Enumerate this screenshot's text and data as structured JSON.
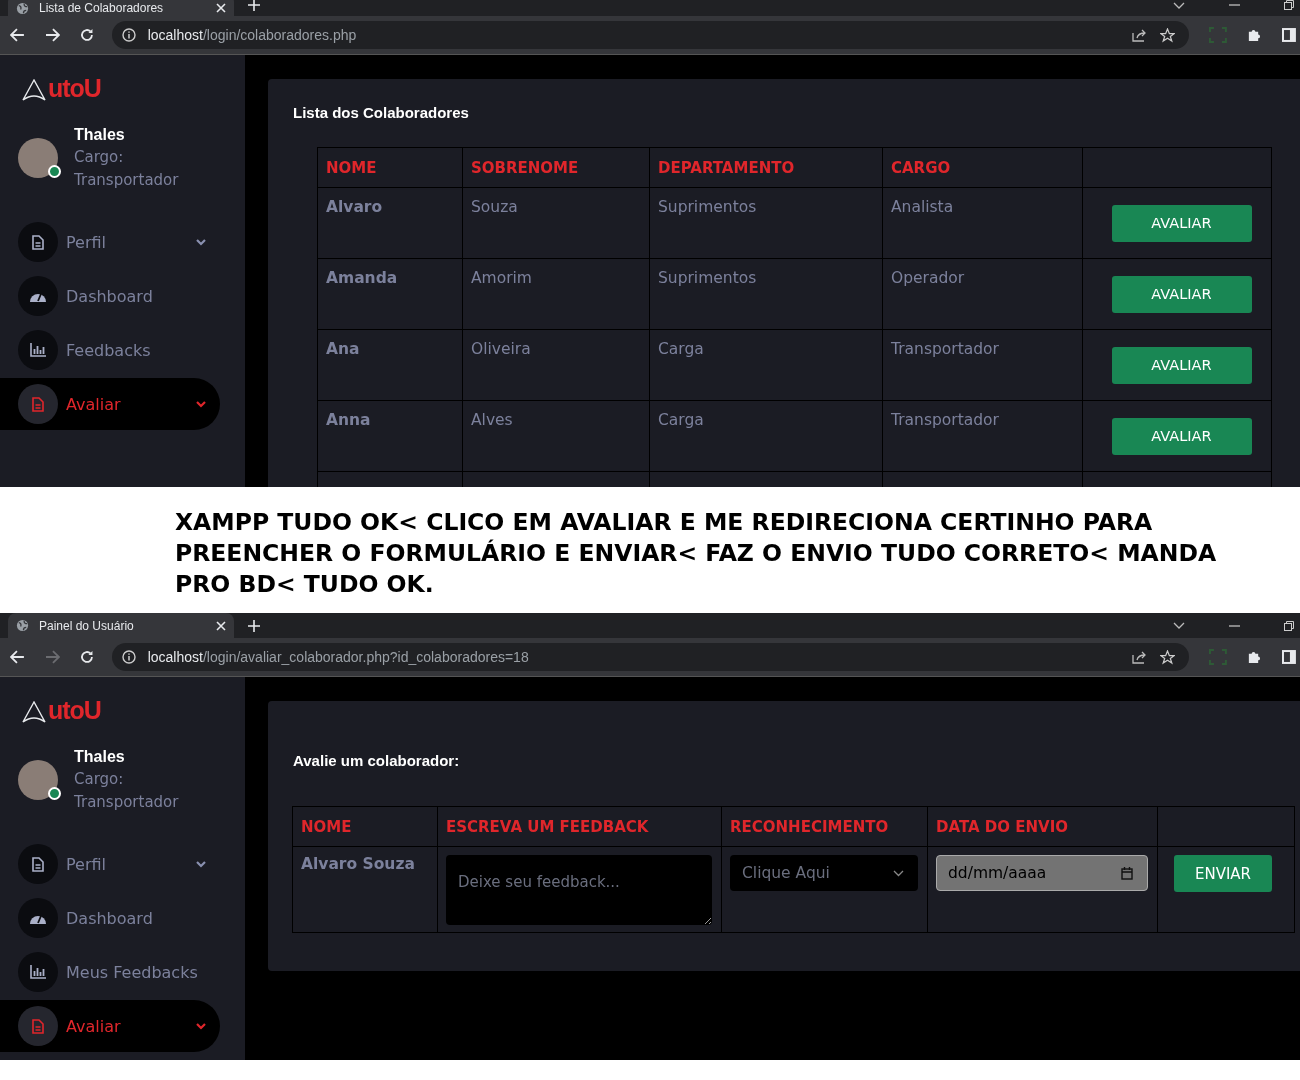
{
  "windows": [
    {
      "kind": "list",
      "tab_title": "Lista de Colaboradores",
      "url_host": "localhost",
      "url_path": "/login/colaboradores.php",
      "forward_disabled": false,
      "sidebar": {
        "brand": "utoU",
        "user": "Thales",
        "role_label": "Cargo:",
        "role": "Transportador",
        "online": true,
        "items": [
          {
            "kind": "file",
            "label": "Perfil",
            "caret": true,
            "selected": false
          },
          {
            "kind": "gauge",
            "label": "Dashboard",
            "caret": false,
            "selected": false
          },
          {
            "kind": "chart",
            "label": "Feedbacks",
            "caret": false,
            "selected": false
          },
          {
            "kind": "file",
            "label": "Avaliar",
            "caret": true,
            "selected": true
          }
        ]
      },
      "card_title": "Lista dos Colaboradores",
      "columns": [
        "NOME",
        "SOBRENOME",
        "DEPARTAMENTO",
        "CARGO"
      ],
      "rows": [
        {
          "cells": [
            "Alvaro",
            "Souza",
            "Suprimentos",
            "Analista"
          ],
          "button": "AVALIAR"
        },
        {
          "cells": [
            "Amanda",
            "Amorim",
            "Suprimentos",
            "Operador"
          ],
          "button": "AVALIAR"
        },
        {
          "cells": [
            "Ana",
            "Oliveira",
            "Carga",
            "Transportador"
          ],
          "button": "AVALIAR"
        },
        {
          "cells": [
            "Anna",
            "Alves",
            "Carga",
            "Transportador"
          ],
          "button": "AVALIAR"
        }
      ]
    },
    {
      "kind": "form",
      "tab_title": "Painel do Usuário",
      "url_host": "localhost",
      "url_path": "/login/avaliar_colaborador.php?id_colaboradores=18",
      "forward_disabled": true,
      "sidebar": {
        "brand": "utoU",
        "user": "Thales",
        "role_label": "Cargo:",
        "role": "Transportador",
        "online": true,
        "items": [
          {
            "kind": "file",
            "label": "Perfil",
            "caret": true,
            "selected": false
          },
          {
            "kind": "gauge",
            "label": "Dashboard",
            "caret": false,
            "selected": false
          },
          {
            "kind": "chart",
            "label": "Meus Feedbacks",
            "caret": false,
            "selected": false
          },
          {
            "kind": "file",
            "label": "Avaliar",
            "caret": true,
            "selected": true
          }
        ]
      },
      "card_title": "Avalie um colaborador:",
      "columns": [
        "NOME",
        "ESCREVA UM FEEDBACK",
        "RECONHECIMENTO",
        "DATA DO ENVIO"
      ],
      "form": {
        "name": "Alvaro Souza",
        "feedback_placeholder": "Deixe seu feedback...",
        "select_value": "Clique Aqui",
        "date_value": "dd/mm/aaaa",
        "button": "ENVIAR"
      }
    }
  ],
  "caption": "XAMPP TUDO OK< CLICO EM AVALIAR E ME REDIRECIONA CERTINHO PARA PREENCHER O FORMULÁRIO E ENVIAR< FAZ O ENVIO TUDO CORRETO< MANDA PRO BD< TUDO OK."
}
